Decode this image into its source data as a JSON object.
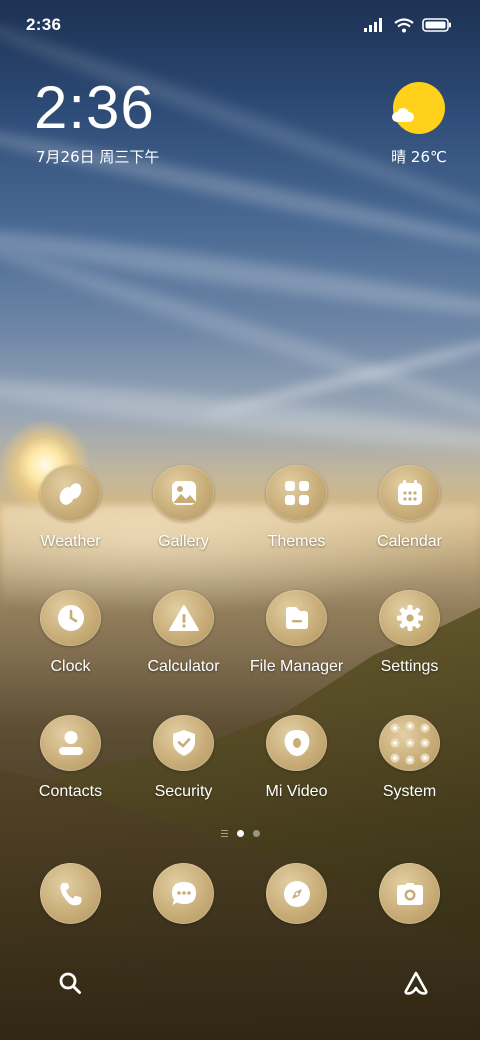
{
  "status_bar": {
    "time": "2:36",
    "icons": [
      "signal-icon",
      "wifi-icon",
      "battery-icon"
    ]
  },
  "clock_widget": {
    "time": "2:36",
    "date": "7月26日 周三下午"
  },
  "weather_widget": {
    "icon": "sun-cloud-icon",
    "text": "晴 26℃",
    "sun_color": "#ffd11a"
  },
  "apps": [
    {
      "label": "Weather",
      "icon": "weather-icon"
    },
    {
      "label": "Gallery",
      "icon": "gallery-icon"
    },
    {
      "label": "Themes",
      "icon": "themes-icon"
    },
    {
      "label": "Calendar",
      "icon": "calendar-icon"
    },
    {
      "label": "Clock",
      "icon": "clock-icon"
    },
    {
      "label": "Calculator",
      "icon": "warning-icon"
    },
    {
      "label": "File Manager",
      "icon": "folder-icon"
    },
    {
      "label": "Settings",
      "icon": "gear-icon"
    },
    {
      "label": "Contacts",
      "icon": "contacts-icon"
    },
    {
      "label": "Security",
      "icon": "shield-icon"
    },
    {
      "label": "Mi Video",
      "icon": "video-icon"
    },
    {
      "label": "System",
      "icon": "folder-grid-icon"
    }
  ],
  "dock": [
    {
      "icon": "phone-icon"
    },
    {
      "icon": "messages-icon"
    },
    {
      "icon": "browser-compass-icon"
    },
    {
      "icon": "camera-icon"
    }
  ],
  "page_indicator": {
    "pages": 2,
    "active": 1
  },
  "bottom_bar": {
    "left_icon": "search-icon",
    "right_icon": "assistant-icon"
  },
  "colors": {
    "icon_gold": "#c8ad78",
    "glyph": "#ffffff"
  }
}
